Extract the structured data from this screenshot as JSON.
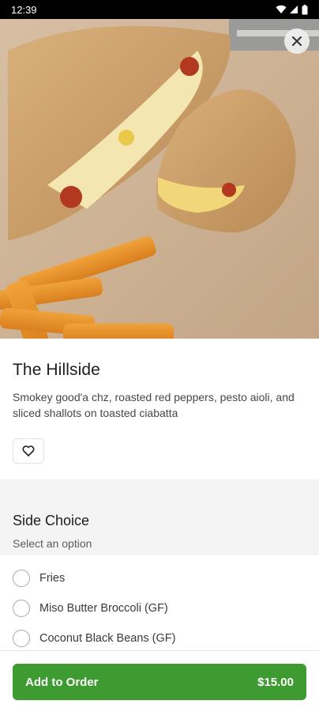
{
  "status_bar": {
    "time": "12:39"
  },
  "hero": {
    "image_subject": "sandwich-with-fries"
  },
  "item": {
    "title": "The Hillside",
    "description": "Smokey good'a chz, roasted red peppers, pesto aioli, and sliced shallots on toasted ciabatta"
  },
  "side_choice": {
    "title": "Side Choice",
    "subtitle": "Select an option",
    "options": [
      {
        "label": "Fries"
      },
      {
        "label": "Miso Butter Broccoli (GF)"
      },
      {
        "label": "Coconut Black Beans (GF)"
      }
    ]
  },
  "footer": {
    "add_label": "Add to Order",
    "price": "$15.00"
  },
  "colors": {
    "accent": "#3e9b32"
  }
}
